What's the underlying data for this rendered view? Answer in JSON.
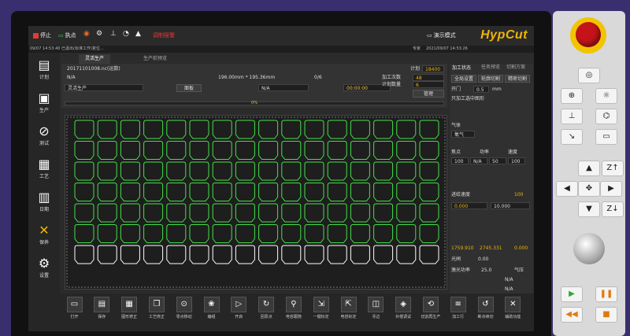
{
  "topbar": {
    "stop_label": "停止",
    "run_label": "执点",
    "alarm_label": "调制报警",
    "demo_mode_label": "演示模式",
    "logo": "HypCut"
  },
  "infobar": {
    "log_text": "09/07 14:53:40 已退出(标准工作)复位...",
    "meta_label": "专家",
    "datetime": "2021/09/07 14:53:26"
  },
  "sidebar": {
    "items": [
      {
        "label": "计划",
        "icon": "plan-icon"
      },
      {
        "label": "生产",
        "icon": "production-icon"
      },
      {
        "label": "测试",
        "icon": "test-icon"
      },
      {
        "label": "工艺",
        "icon": "process-icon"
      },
      {
        "label": "日期",
        "icon": "calendar-icon"
      },
      {
        "label": "保养",
        "icon": "maintenance-icon"
      },
      {
        "label": "设置",
        "icon": "settings-icon"
      }
    ]
  },
  "tabs": [
    {
      "label": "灵活生产"
    },
    {
      "label": "生产前预览"
    }
  ],
  "job": {
    "file": "20171101008.nc(运数)",
    "material": "N/A",
    "size": "196.00mm * 195.36mm",
    "count": "0/6",
    "mode_value": "灵活生产",
    "mode_button": "面板",
    "time_a": "N/A",
    "time_b": "00:00:00",
    "progress_text": "0%",
    "progress": 0,
    "right_title": "计划",
    "right_value": "18400",
    "processing_count_label": "加工次数",
    "processing_count": "48",
    "plan_count_label": "计划数量",
    "plan_count": "6",
    "manage_button": "管理"
  },
  "right_panel": {
    "title": "加工状态",
    "tabs": [
      "任务预览",
      "切割方案"
    ],
    "buttons": [
      "全局设置",
      "轮廓切割",
      "精密切割"
    ],
    "circle_label": "开门",
    "circle_value": "0.5",
    "circle_unit": "mm",
    "cut_in_label": "只加工选中图形",
    "gas_label": "气体",
    "gas_value": "氧气",
    "focus_label": "焦点",
    "power_label": "功率",
    "speed_label": "速度",
    "values": [
      "100",
      "N/A",
      "50",
      "100"
    ],
    "progress_label": "进给速度",
    "progress_value": "100",
    "unit_x": "0.000",
    "unit_y": "10.000",
    "coord_x": "1759.910",
    "coord_y": "2745.331",
    "coord_z": "0.000",
    "laser_label": "光闸",
    "laser_value": "0.00",
    "focus2_label": "激光功率",
    "focus2_value": "25.0",
    "na_a": "N/A",
    "na_b": "N/A",
    "gas_pressure_label": "气压"
  },
  "bottombar": {
    "items": [
      {
        "label": "打开",
        "icon": "folder-icon"
      },
      {
        "label": "保存",
        "icon": "save-icon"
      },
      {
        "label": "图形修正",
        "icon": "edit-icon"
      },
      {
        "label": "工艺修正",
        "icon": "copy-icon"
      },
      {
        "label": "零点移动",
        "icon": "origin-icon"
      },
      {
        "label": "编组",
        "icon": "group-icon"
      },
      {
        "label": "开启",
        "icon": "play-icon"
      },
      {
        "label": "回原点",
        "icon": "home-icon"
      },
      {
        "label": "电容跟随",
        "icon": "capacitor-icon"
      },
      {
        "label": "一键标定",
        "icon": "calibrate-icon"
      },
      {
        "label": "电容标定",
        "icon": "calibrate2-icon"
      },
      {
        "label": "寻边",
        "icon": "edge-icon"
      },
      {
        "label": "补偿调试",
        "icon": "debug-icon"
      },
      {
        "label": "切割再生产",
        "icon": "restart-icon"
      },
      {
        "label": "加工行",
        "icon": "line-icon"
      },
      {
        "label": "断点续切",
        "icon": "resume-icon"
      },
      {
        "label": "辅助功能",
        "icon": "tools-icon"
      }
    ]
  },
  "keypad": {
    "z_up": "Z↑",
    "z_down": "Z↓"
  },
  "colors": {
    "accent": "#f0b400",
    "contour": "#45e04a",
    "stop": "#c4141a"
  }
}
